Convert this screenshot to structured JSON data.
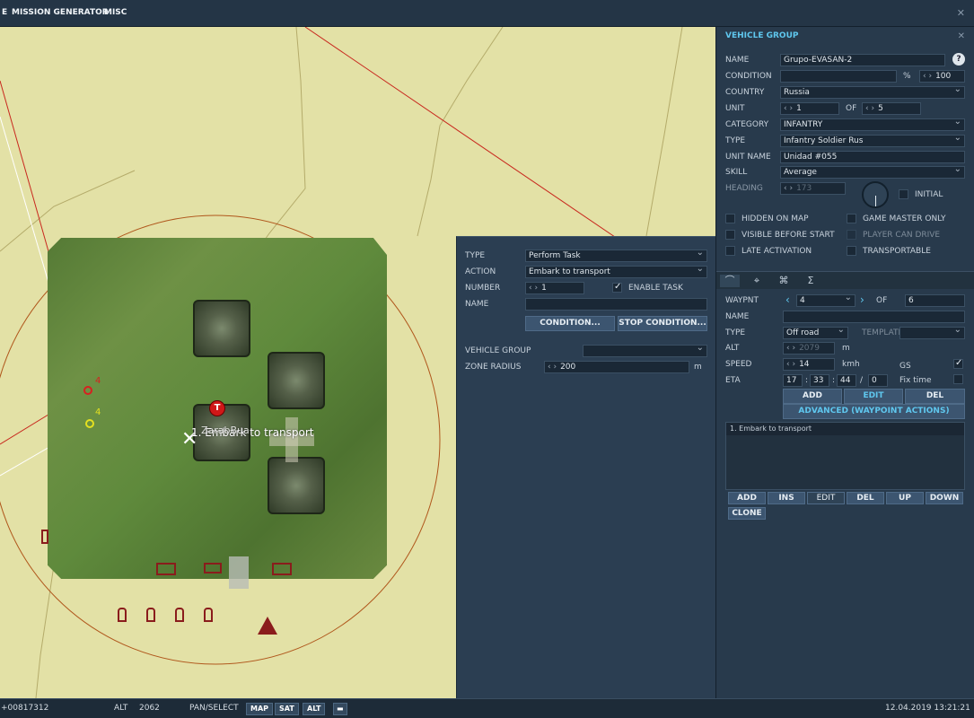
{
  "menu": {
    "items": [
      "E",
      "MISSION GENERATOR",
      "MISC"
    ]
  },
  "map": {
    "waypoint_red_number": "4",
    "waypoint_yellow_number": "4",
    "overlay_text": "1. Embark to transport",
    "unit_label": "ZarabBua"
  },
  "task": {
    "type_label": "TYPE",
    "type_value": "Perform Task",
    "action_label": "ACTION",
    "action_value": "Embark to transport",
    "number_label": "NUMBER",
    "number_value": "1",
    "enable_task_label": "ENABLE TASK",
    "name_label": "NAME",
    "name_value": "",
    "condition_btn": "CONDITION...",
    "stop_condition_btn": "STOP CONDITION...",
    "vehicle_group_label": "VEHICLE GROUP",
    "vehicle_group_value": "",
    "zone_radius_label": "ZONE RADIUS",
    "zone_radius_value": "200",
    "zone_radius_unit": "m"
  },
  "group": {
    "title": "VEHICLE GROUP",
    "name_label": "NAME",
    "name_value": "Grupo-EVASAN-2",
    "condition_label": "CONDITION",
    "condition_pct": "%",
    "condition_value": "100",
    "country_label": "COUNTRY",
    "country_value": "Russia",
    "unit_label": "UNIT",
    "unit_value": "1",
    "unit_of": "OF",
    "unit_total": "5",
    "category_label": "CATEGORY",
    "category_value": "INFANTRY",
    "type_label": "TYPE",
    "type_value": "Infantry Soldier Rus",
    "unit_name_label": "UNIT NAME",
    "unit_name_value": "Unidad #055",
    "skill_label": "SKILL",
    "skill_value": "Average",
    "heading_label": "HEADING",
    "heading_value": "173",
    "initial_label": "INITIAL",
    "hidden_on_map": "HIDDEN ON MAP",
    "game_master_only": "GAME MASTER ONLY",
    "visible_before_start": "VISIBLE BEFORE START",
    "player_can_drive": "PLAYER CAN DRIVE",
    "late_activation": "LATE ACTIVATION",
    "transportable": "TRANSPORTABLE"
  },
  "waypoint": {
    "waypnt_label": "WAYPNT",
    "waypnt_value": "4",
    "of_label": "OF",
    "of_value": "6",
    "name_label": "NAME",
    "name_value": "",
    "type_label": "TYPE",
    "type_value": "Off road",
    "template_label": "TEMPLATE",
    "alt_label": "ALT",
    "alt_value": "2079",
    "alt_unit": "m",
    "speed_label": "SPEED",
    "speed_value": "14",
    "speed_unit": "kmh",
    "gs_label": "GS",
    "eta_label": "ETA",
    "eta_h": "17",
    "eta_m": "33",
    "eta_s": "44",
    "eta_sep": "/",
    "eta_d": "0",
    "fix_time_label": "Fix time",
    "add_btn": "ADD",
    "edit_btn": "EDIT",
    "del_btn": "DEL",
    "advanced_btn": "ADVANCED (WAYPOINT ACTIONS)",
    "actions": [
      "1. Embark to transport"
    ],
    "list_add": "ADD",
    "list_ins": "INS",
    "list_edit": "EDIT",
    "list_del": "DEL",
    "list_up": "UP",
    "list_down": "DOWN",
    "list_clone": "CLONE"
  },
  "status": {
    "coords": "+00817312",
    "alt_label": "ALT",
    "alt_value": "2062",
    "mode": "PAN/SELECT",
    "map_btn": "MAP",
    "sat_btn": "SAT",
    "alt_btn": "ALT",
    "datetime": "12.04.2019 13:21:21"
  }
}
